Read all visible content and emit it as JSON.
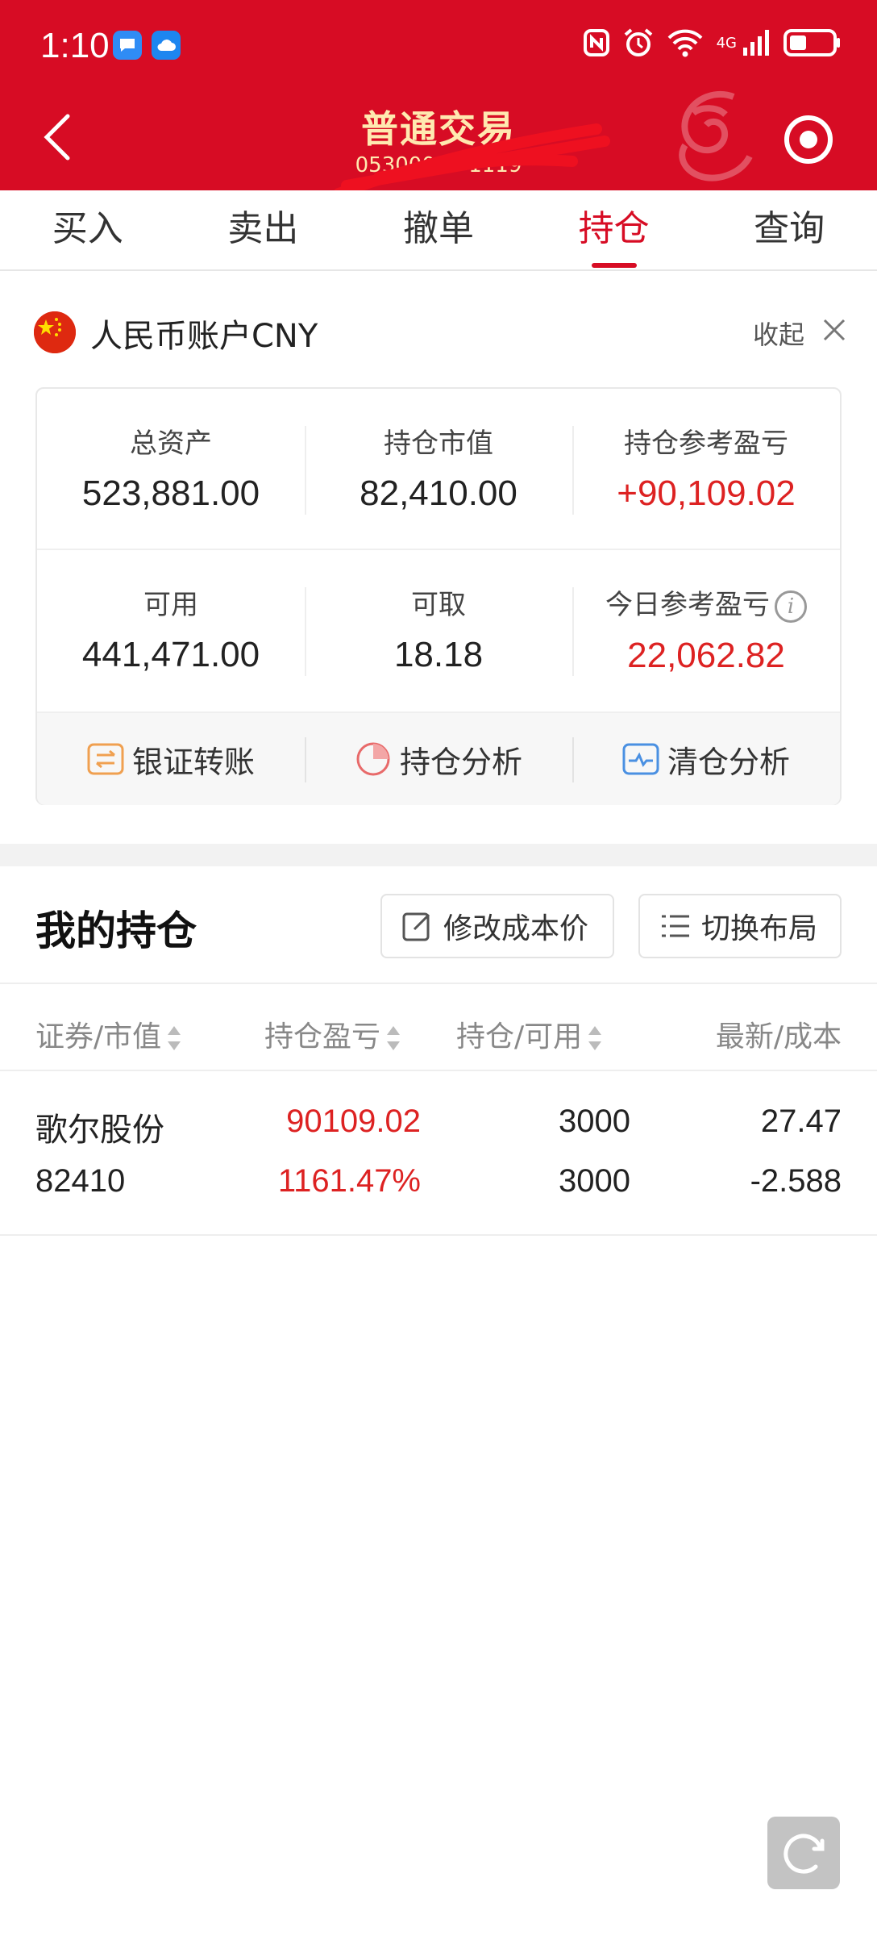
{
  "status_bar": {
    "time": "1:10",
    "network": "4G"
  },
  "header": {
    "title": "普通交易",
    "account_no": "0530000···1119"
  },
  "tabs": [
    {
      "label": "买入",
      "active": false
    },
    {
      "label": "卖出",
      "active": false
    },
    {
      "label": "撤单",
      "active": false
    },
    {
      "label": "持仓",
      "active": true
    },
    {
      "label": "查询",
      "active": false
    }
  ],
  "account": {
    "title": "人民币账户CNY",
    "collapse_label": "收起",
    "stats": {
      "total_assets": {
        "label": "总资产",
        "value": "523,881.00"
      },
      "market_value": {
        "label": "持仓市值",
        "value": "82,410.00"
      },
      "position_pl": {
        "label": "持仓参考盈亏",
        "value": "+90,109.02"
      },
      "available": {
        "label": "可用",
        "value": "441,471.00"
      },
      "withdrawable": {
        "label": "可取",
        "value": "18.18"
      },
      "today_pl": {
        "label": "今日参考盈亏",
        "value": "22,062.82"
      }
    },
    "actions": [
      {
        "label": "银证转账",
        "icon": "transfer-icon"
      },
      {
        "label": "持仓分析",
        "icon": "pie-chart-icon"
      },
      {
        "label": "清仓分析",
        "icon": "pulse-chart-icon"
      }
    ]
  },
  "holdings": {
    "title": "我的持仓",
    "modify_cost_label": "修改成本价",
    "switch_layout_label": "切换布局",
    "columns": [
      "证券/市值",
      "持仓盈亏",
      "持仓/可用",
      "最新/成本"
    ],
    "rows": [
      {
        "name": "歌尔股份",
        "market_value": "82410",
        "pl": "90109.02",
        "pl_pct": "1161.47%",
        "position": "3000",
        "available": "3000",
        "latest": "27.47",
        "cost": "-2.588"
      }
    ]
  },
  "colors": {
    "brand_red": "#d70c24",
    "gain_red": "#dd2222",
    "title_gold": "#ffe9b0"
  }
}
